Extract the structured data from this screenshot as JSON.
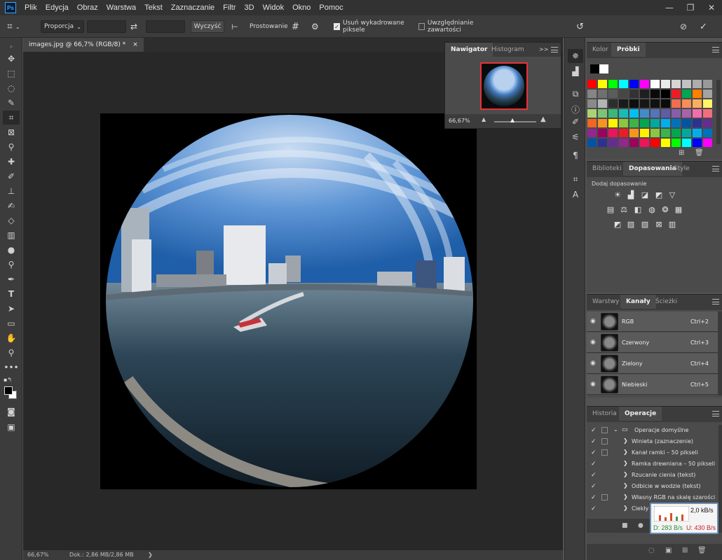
{
  "app": {
    "logo": "Ps"
  },
  "menu": [
    "Plik",
    "Edycja",
    "Obraz",
    "Warstwa",
    "Tekst",
    "Zaznaczanie",
    "Filtr",
    "3D",
    "Widok",
    "Okno",
    "Pomoc"
  ],
  "window_controls": [
    "—",
    "❐",
    "✕"
  ],
  "options": {
    "ratio_select": "Proporcja",
    "clear_button": "Wyczyść",
    "straighten_label": "Prostowanie",
    "delete_cropped_label": "Usuń wykadrowane piksele",
    "delete_cropped_checked": true,
    "content_aware_label": "Uwzględnianie zawartości",
    "content_aware_checked": false
  },
  "document": {
    "tab_title": "images.jpg @ 66,7% (RGB/8) *",
    "tab_close": "×"
  },
  "status": {
    "zoom": "66,67%",
    "doc": "Dok.: 2,86 MB/2,86 MB",
    "arrow": "❯"
  },
  "navigator": {
    "tabs": [
      "Nawigator",
      "Histogram"
    ],
    "zoom": "66,67%",
    "expand": ">>",
    "slider_fraction": 0.45
  },
  "color_panel": {
    "tabs": [
      "Kolor",
      "Próbki"
    ],
    "active_tab": 1
  },
  "adjust_panel": {
    "tabs": [
      "Biblioteki",
      "Dopasowania",
      "Style"
    ],
    "active_tab": 1,
    "heading": "Dodaj dopasowanie"
  },
  "layers_panel": {
    "tabs": [
      "Warstwy",
      "Kanały",
      "Ścieżki"
    ],
    "active_tab": 1,
    "channels": [
      {
        "name": "RGB",
        "shortcut": "Ctrl+2"
      },
      {
        "name": "Czerwony",
        "shortcut": "Ctrl+3"
      },
      {
        "name": "Zielony",
        "shortcut": "Ctrl+4"
      },
      {
        "name": "Niebieski",
        "shortcut": "Ctrl+5"
      }
    ]
  },
  "actions_panel": {
    "tabs": [
      "Historia",
      "Operacje"
    ],
    "active_tab": 1,
    "set_name": "Operacje domyślne",
    "actions": [
      {
        "name": "Winieta (zaznaczenie)",
        "dialog": true
      },
      {
        "name": "Kanał ramki – 50 pikseli",
        "dialog": true
      },
      {
        "name": "Ramka drewniana – 50 pikseli",
        "dialog": false
      },
      {
        "name": "Rzucanie cienia (tekst)",
        "dialog": false
      },
      {
        "name": "Odbicie w wodzie (tekst)",
        "dialog": false
      },
      {
        "name": "Własny RGB na skalę szarości",
        "dialog": true
      },
      {
        "name": "Ciekły",
        "dialog": false
      }
    ]
  },
  "net_monitor": {
    "rate": "2,0 kB/s",
    "down": "D: 283 B/s",
    "up": "U: 430 B/s"
  },
  "colors": {
    "swatch_rows": [
      [
        "#ff0000",
        "#ffff00",
        "#00ff00",
        "#00ffff",
        "#0000ff",
        "#ff00ff",
        "#ffffff",
        "#ebebeb",
        "#d6d6d6",
        "#c2c2c2",
        "#adadad",
        "#999999"
      ],
      [
        "#858585",
        "#707070",
        "#5c5c5c",
        "#474747",
        "#333333",
        "#1f1f1f",
        "#0a0a0a",
        "#000000",
        "#ed1c24",
        "#00a651",
        "#ff7f00",
        "#a3a3a3"
      ],
      [
        "#8a8a8a",
        "#b4b4b4",
        "#2d2d2d",
        "#1a1a1a",
        "#0e0e0e",
        "#161616",
        "#111111",
        "#0b0b0b",
        "#f26c4f",
        "#f68e55",
        "#fbaf5d",
        "#fff568"
      ],
      [
        "#acd373",
        "#7cc576",
        "#3bb878",
        "#1abbb4",
        "#00bff3",
        "#438ccb",
        "#5574b9",
        "#605ca8",
        "#855fa8",
        "#a763a8",
        "#f06eaa",
        "#f26d7d"
      ],
      [
        "#f26522",
        "#f7941d",
        "#fff200",
        "#8dc63f",
        "#39b54a",
        "#00a651",
        "#00a99d",
        "#00aeef",
        "#0072bc",
        "#0054a6",
        "#2e3192",
        "#662d91"
      ],
      [
        "#92278f",
        "#9e005d",
        "#ed145b",
        "#ed1c24",
        "#f7941d",
        "#fff200",
        "#8dc63f",
        "#39b54a",
        "#00a651",
        "#00a99d",
        "#00aeef",
        "#0072bc"
      ],
      [
        "#0054a6",
        "#2e3192",
        "#662d91",
        "#92278f",
        "#9e005d",
        "#ed145b",
        "#ff0000",
        "#ffff00",
        "#00ff00",
        "#00ffff",
        "#0000ff",
        "#ff00ff"
      ]
    ]
  }
}
